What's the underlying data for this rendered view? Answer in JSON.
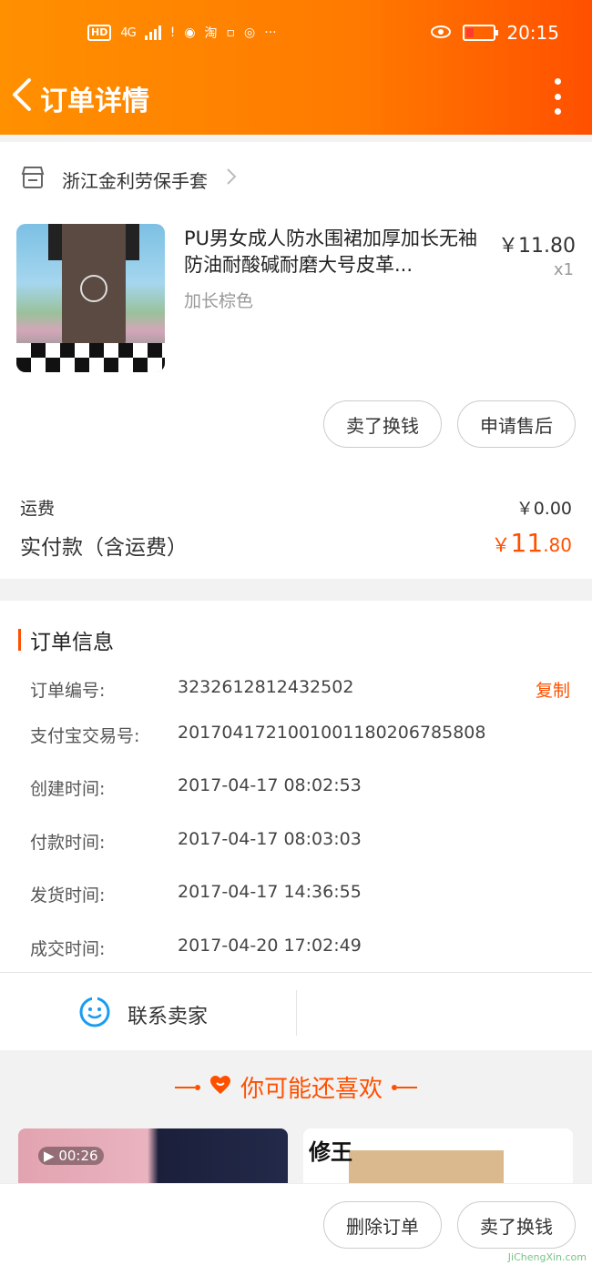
{
  "status_bar": {
    "hd": "HD",
    "network": "4G",
    "app_icons": [
      "!",
      "◉",
      "淘",
      "▫",
      "◎",
      "···"
    ],
    "time": "20:15",
    "icons": [
      "eye-icon",
      "battery-icon",
      "signal-icon"
    ]
  },
  "header": {
    "title": "订单详情",
    "bg_colors": [
      "#ff9000",
      "#ff5000"
    ]
  },
  "shop": {
    "name": "浙江金利劳保手套"
  },
  "product": {
    "name": "PU男女成人防水围裙加厚加长无袖防油耐酸碱耐磨大号皮革...",
    "sku": "加长棕色",
    "price": "￥11.80",
    "qty": "x1"
  },
  "item_actions": {
    "sell_label": "卖了换钱",
    "after_sale_label": "申请售后"
  },
  "summary": {
    "shipping_label": "运费",
    "shipping_value": "￥0.00",
    "paid_label": "实付款（含运费）",
    "paid_symbol": "￥",
    "paid_int": "11",
    "paid_dec": ".80"
  },
  "order_info": {
    "title": "订单信息",
    "copy_label": "复制",
    "rows": [
      {
        "key": "订单编号:",
        "value": "3232612812432502"
      },
      {
        "key": "支付宝交易号:",
        "value": "2017041721001001180206785808"
      },
      {
        "key": "创建时间:",
        "value": "2017-04-17 08:02:53"
      },
      {
        "key": "付款时间:",
        "value": "2017-04-17 08:03:03"
      },
      {
        "key": "发货时间:",
        "value": "2017-04-17 14:36:55"
      },
      {
        "key": "成交时间:",
        "value": "2017-04-20 17:02:49"
      }
    ],
    "contact_label": "联系卖家"
  },
  "recommend": {
    "title": "你可能还喜欢",
    "items": [
      {
        "video_time": "00:26"
      },
      {
        "brand": "修王"
      }
    ]
  },
  "bottom_bar": {
    "delete_label": "删除订单",
    "sell_label": "卖了换钱"
  },
  "watermark": "JiChengXin.com",
  "accent_color": "#ff5000"
}
